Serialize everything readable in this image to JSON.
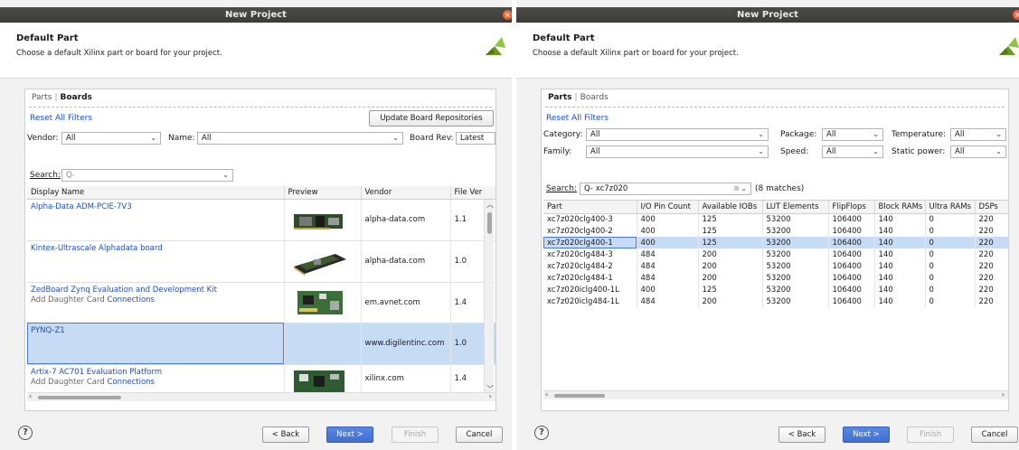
{
  "left": {
    "title": "New Project",
    "header": {
      "title": "Default Part",
      "subtitle": "Choose a default Xilinx part or board for your project."
    },
    "tabs": {
      "parts": "Parts",
      "sep": "|",
      "boards": "Boards"
    },
    "reset_filters": "Reset All Filters",
    "update_repos": "Update Board Repositories",
    "filters": {
      "vendor_label": "Vendor:",
      "vendor_value": "All",
      "name_label": "Name:",
      "name_value": "All",
      "rev_label": "Board Rev:",
      "rev_value": "Latest"
    },
    "search": {
      "label": "Search:",
      "placeholder": "Q-"
    },
    "columns": [
      "Display Name",
      "Preview",
      "Vendor",
      "File Ver"
    ],
    "rows": [
      {
        "name": "Alpha-Data ADM-PCIE-7V3",
        "add": "",
        "conn": "",
        "vendor": "alpha-data.com",
        "ver": "1.1"
      },
      {
        "name": "Kintex-Ultrascale Alphadata board",
        "add": "",
        "conn": "",
        "vendor": "alpha-data.com",
        "ver": "1.0"
      },
      {
        "name": "ZedBoard Zynq Evaluation and Development Kit",
        "add": "Add Daughter Card",
        "conn": "Connections",
        "vendor": "em.avnet.com",
        "ver": "1.4"
      },
      {
        "name": "PYNQ-Z1",
        "add": "",
        "conn": "",
        "vendor": "www.digilentinc.com",
        "ver": "1.0"
      },
      {
        "name": "Artix-7 AC701 Evaluation Platform",
        "add": "Add Daughter Card",
        "conn": "Connections",
        "vendor": "xilinx.com",
        "ver": "1.4"
      }
    ],
    "buttons": {
      "help": "?",
      "back": "< Back",
      "next": "Next >",
      "finish": "Finish",
      "cancel": "Cancel"
    }
  },
  "right": {
    "title": "New Project",
    "header": {
      "title": "Default Part",
      "subtitle": "Choose a default Xilinx part or board for your project."
    },
    "tabs": {
      "parts": "Parts",
      "sep": "|",
      "boards": "Boards"
    },
    "reset_filters": "Reset All Filters",
    "filters": {
      "category_label": "Category:",
      "category_value": "All",
      "family_label": "Family:",
      "family_value": "All",
      "package_label": "Package:",
      "package_value": "All",
      "speed_label": "Speed:",
      "speed_value": "All",
      "temperature_label": "Temperature:",
      "temperature_value": "All",
      "static_power_label": "Static power:",
      "static_power_value": "All"
    },
    "search": {
      "label": "Search:",
      "value": "Q- xc7z020",
      "matches": "(8 matches)"
    },
    "columns": [
      "Part",
      "I/O Pin Count",
      "Available IOBs",
      "LUT Elements",
      "FlipFlops",
      "Block RAMs",
      "Ultra RAMs",
      "DSPs"
    ],
    "rows": [
      [
        "xc7z020clg400-3",
        "400",
        "125",
        "53200",
        "106400",
        "140",
        "0",
        "220"
      ],
      [
        "xc7z020clg400-2",
        "400",
        "125",
        "53200",
        "106400",
        "140",
        "0",
        "220"
      ],
      [
        "xc7z020clg400-1",
        "400",
        "125",
        "53200",
        "106400",
        "140",
        "0",
        "220"
      ],
      [
        "xc7z020clg484-3",
        "484",
        "200",
        "53200",
        "106400",
        "140",
        "0",
        "220"
      ],
      [
        "xc7z020clg484-2",
        "484",
        "200",
        "53200",
        "106400",
        "140",
        "0",
        "220"
      ],
      [
        "xc7z020clg484-1",
        "484",
        "200",
        "53200",
        "106400",
        "140",
        "0",
        "220"
      ],
      [
        "xc7z020iclg400-1L",
        "400",
        "125",
        "53200",
        "106400",
        "140",
        "0",
        "220"
      ],
      [
        "xc7z020iclg484-1L",
        "484",
        "200",
        "53200",
        "106400",
        "140",
        "0",
        "220"
      ]
    ],
    "buttons": {
      "help": "?",
      "back": "< Back",
      "next": "Next >",
      "finish": "Finish",
      "cancel": "Cancel"
    }
  },
  "colors": {
    "accent": "#3f6fd1",
    "selection": "#c8dbf5",
    "link": "#1d4fbf"
  }
}
